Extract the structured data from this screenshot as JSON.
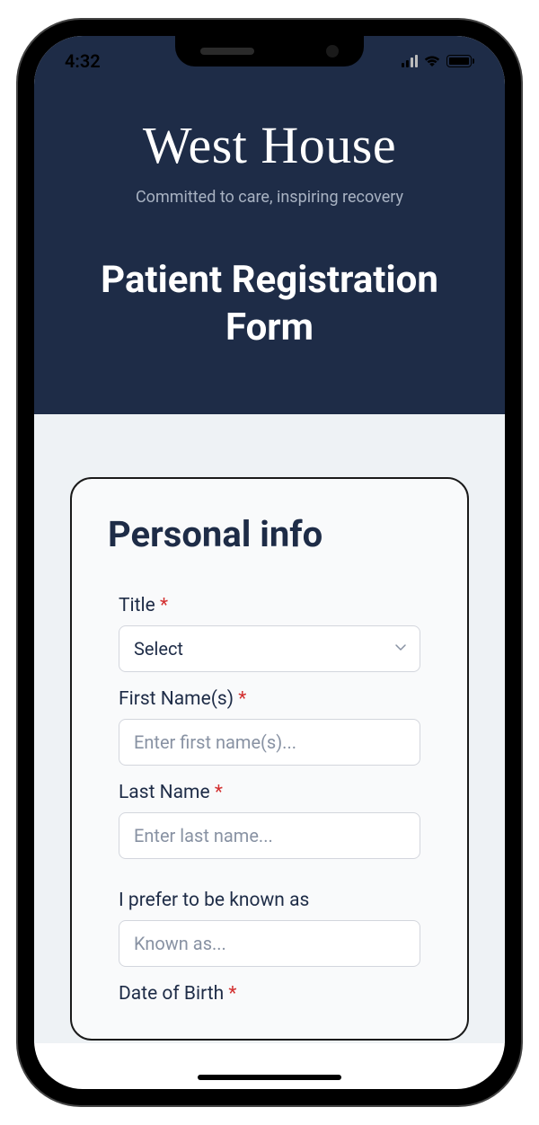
{
  "status": {
    "time": "4:32"
  },
  "header": {
    "brand": "West House",
    "tagline": "Committed to care, inspiring recovery",
    "form_title": "Patient Registration Form"
  },
  "form": {
    "section_heading": "Personal info",
    "fields": {
      "title": {
        "label": "Title",
        "required": "*",
        "selected": "Select"
      },
      "first_name": {
        "label": "First Name(s)",
        "required": "*",
        "placeholder": "Enter first name(s)..."
      },
      "last_name": {
        "label": "Last Name",
        "required": "*",
        "placeholder": "Enter last name..."
      },
      "known_as": {
        "label": "I prefer to be known as",
        "placeholder": "Known as..."
      },
      "dob": {
        "label": "Date of Birth",
        "required": "*"
      }
    }
  }
}
